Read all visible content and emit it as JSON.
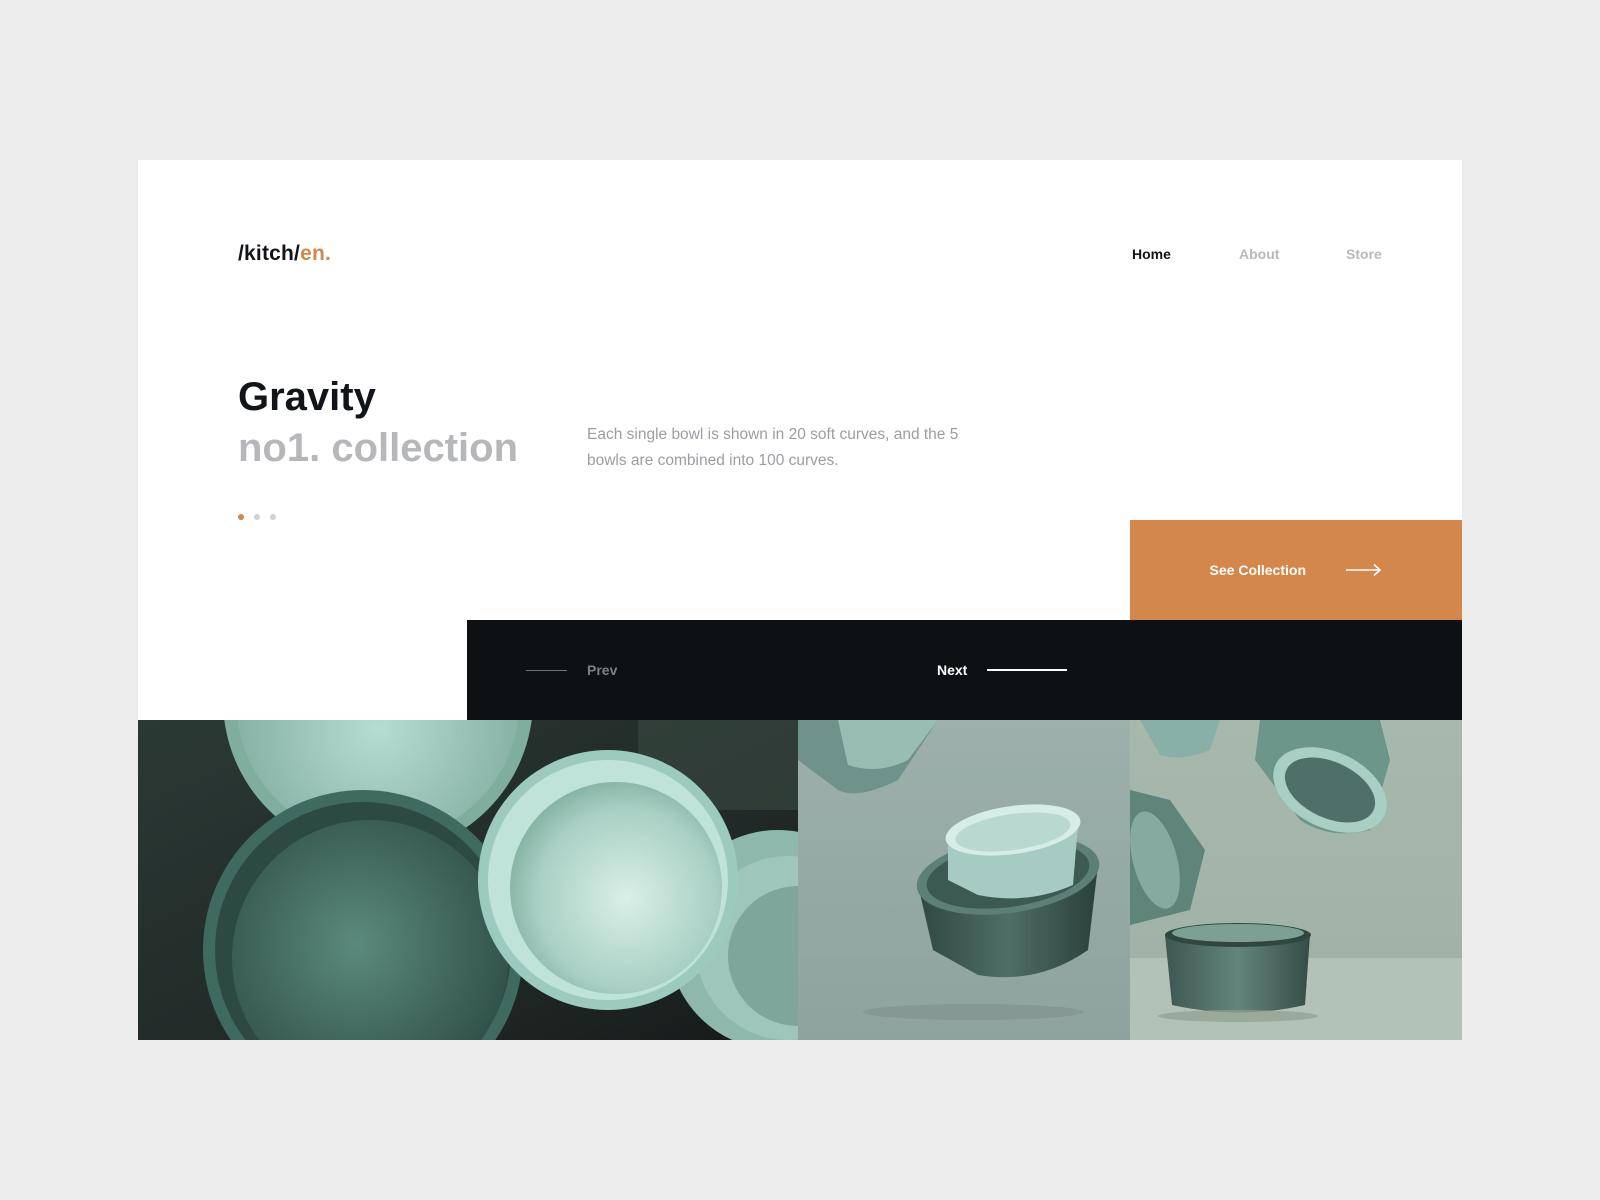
{
  "brand": {
    "logo_main": "/kitch/",
    "logo_accent": "en."
  },
  "nav": {
    "items": [
      {
        "label": "Home",
        "active": true
      },
      {
        "label": "About",
        "active": false
      },
      {
        "label": "Store",
        "active": false
      }
    ]
  },
  "hero": {
    "title": "Gravity",
    "subtitle": "no1. collection",
    "description": "Each single bowl is shown in 20 soft curves, and the 5 bowls are combined into 100 curves.",
    "slides_total": 3,
    "slides_active": 1
  },
  "cta": {
    "label": "See Collection",
    "icon": "arrow-right-icon"
  },
  "slider_nav": {
    "prev_label": "Prev",
    "next_label": "Next"
  },
  "gallery": {
    "images": [
      {
        "name": "bowls-top-view",
        "palette": [
          "#263531",
          "#9fccbf",
          "#c9e6dd"
        ]
      },
      {
        "name": "stacked-bowls-floating",
        "palette": [
          "#97aca7",
          "#3e5a53",
          "#a9d4cb"
        ]
      },
      {
        "name": "bowls-falling",
        "palette": [
          "#a6b6ab",
          "#4b6b63",
          "#8ec0b2"
        ]
      }
    ]
  },
  "colors": {
    "accent": "#d3874a",
    "dark": "#0d1114",
    "background": "#ededed",
    "muted": "#b5b7ba"
  }
}
